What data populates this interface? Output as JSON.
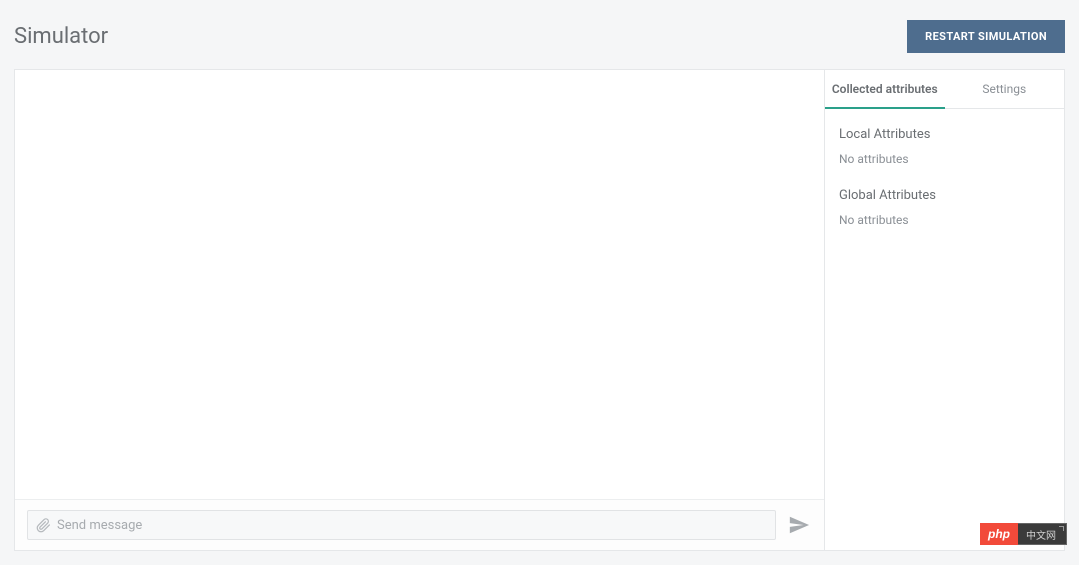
{
  "header": {
    "title": "Simulator",
    "restart_button": "RESTART SIMULATION"
  },
  "tabs": {
    "collected": "Collected attributes",
    "settings": "Settings"
  },
  "attributes": {
    "local_heading": "Local Attributes",
    "local_empty": "No attributes",
    "global_heading": "Global Attributes",
    "global_empty": "No attributes"
  },
  "input": {
    "placeholder": "Send message"
  },
  "badge": {
    "left": "php",
    "right": "中文网"
  }
}
